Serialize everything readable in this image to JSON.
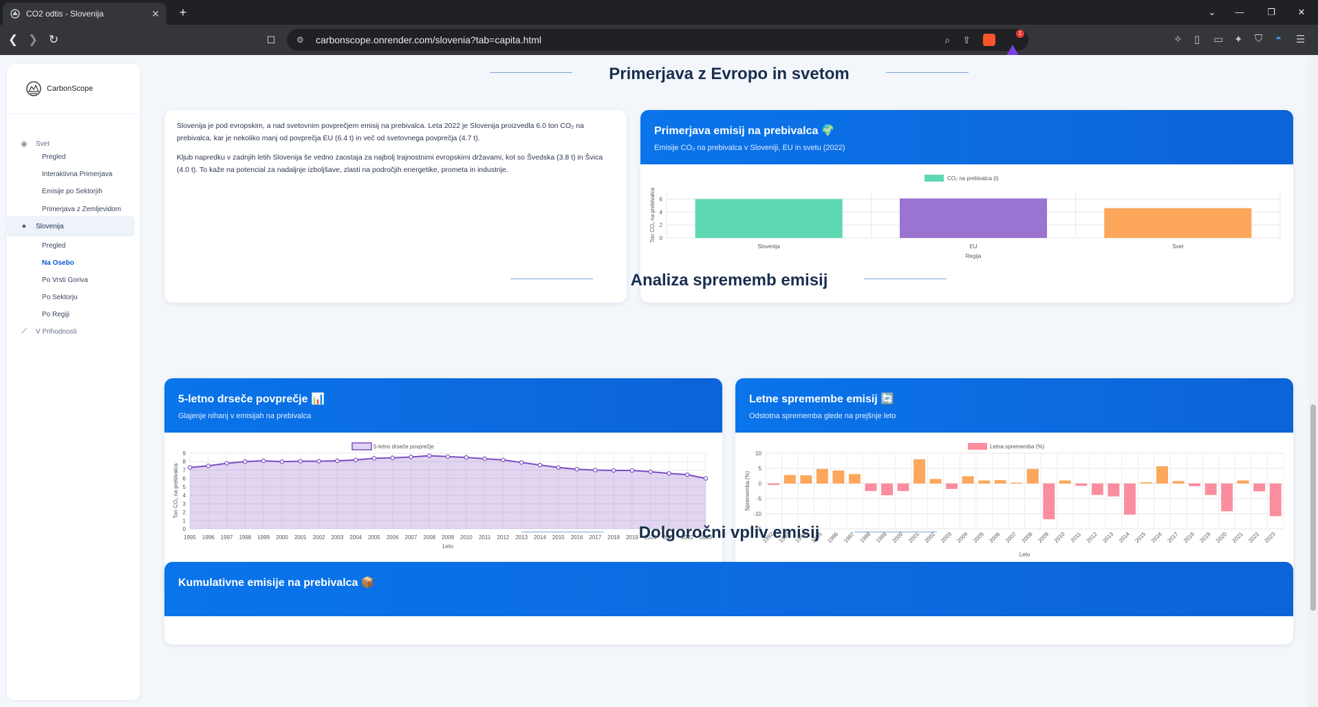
{
  "browser": {
    "tab_title": "CO2 odtis - Slovenija",
    "url": "carbonscope.onrender.com/slovenia?tab=capita.html",
    "reward_count": "1"
  },
  "sidebar": {
    "brand": "CarbonScope",
    "sections": [
      {
        "label": "Svet",
        "icon": "globe-icon",
        "items": [
          "Pregled",
          "Interaktivna Primerjava",
          "Emisije po Sektorjih",
          "Primerjava z Zemljevidom"
        ]
      },
      {
        "label": "Slovenija",
        "icon": "map-pin-icon",
        "items": [
          "Pregled",
          "Na Osebo",
          "Po Vrsti Goriva",
          "Po Sektorju",
          "Po Regiji"
        ]
      },
      {
        "label": "V Prihodnosti",
        "icon": "line-chart-icon",
        "items": []
      }
    ],
    "current_item": "Na Osebo"
  },
  "sections": {
    "europe": "Primerjava z Evropo in svetom",
    "changes": "Analiza sprememb emisij",
    "longterm": "Dolgoročni vpliv emisij"
  },
  "intro": {
    "p1": "Slovenija je pod evropskim, a nad svetovnim povprečjem emisij na prebivalca. Leta 2022 je Slovenija proizvedla 6.0 ton CO₂ na prebivalca, kar je nekoliko manj od povprečja EU (6.4 t) in več od svetovnega povprečja (4.7 t).",
    "p2": "Kljub napredku v zadnjih letih Slovenija še vedno zaostaja za najbolj trajnostnimi evropskimi državami, kot so Švedska (3.8 t) in Švica (4.0 t). To kaže na potencial za nadaljnje izboljšave, zlasti na področjih energetike, prometa in industrije."
  },
  "cards": {
    "compare": {
      "title": "Primerjava emisij na prebivalca 🌍",
      "subtitle": "Emisije CO₂ na prebivalca v Sloveniji, EU in svetu (2022)"
    },
    "rolling": {
      "title": "5-letno drseče povprečje 📊",
      "subtitle": "Glajenje nihanj v emisijah na prebivalca"
    },
    "annual": {
      "title": "Letne spremembe emisij 🔄",
      "subtitle": "Odstotna sprememba glede na prejšnje leto"
    },
    "cumulative": {
      "title": "Kumulativne emisije na prebivalca 📦"
    }
  },
  "chart_data": [
    {
      "type": "bar",
      "categories": [
        "Slovenija",
        "EU",
        "Svet"
      ],
      "series": [
        {
          "name": "CO₂ na prebivalca (t)",
          "values": [
            6.0,
            6.1,
            4.6
          ]
        }
      ],
      "colors": [
        "#5ed8b3",
        "#9b74d1",
        "#fca75b"
      ],
      "xlabel": "Regija",
      "ylabel": "Ton CO₂ na prebivalca",
      "ylim": [
        0,
        7
      ],
      "yticks": [
        0,
        2,
        4,
        6
      ]
    },
    {
      "type": "area",
      "x": [
        "1995",
        "1996",
        "1997",
        "1998",
        "1999",
        "2000",
        "2001",
        "2002",
        "2003",
        "2004",
        "2005",
        "2006",
        "2007",
        "2008",
        "2009",
        "2010",
        "2011",
        "2012",
        "2013",
        "2014",
        "2015",
        "2016",
        "2017",
        "2018",
        "2019",
        "2020",
        "2021",
        "2022",
        "2023"
      ],
      "series": [
        {
          "name": "5-letno drseče povprečje",
          "values": [
            7.3,
            7.5,
            7.8,
            8.0,
            8.1,
            8.0,
            8.05,
            8.05,
            8.1,
            8.2,
            8.4,
            8.45,
            8.55,
            8.7,
            8.6,
            8.5,
            8.35,
            8.2,
            7.9,
            7.6,
            7.3,
            7.1,
            7.0,
            6.95,
            6.95,
            6.8,
            6.6,
            6.45,
            6.0
          ]
        }
      ],
      "color": "#7b4cc4",
      "xlabel": "Leto",
      "ylabel": "Ton CO₂ na prebivalca",
      "ylim": [
        0,
        9
      ],
      "yticks": [
        0,
        1,
        2,
        3,
        4,
        5,
        6,
        7,
        8,
        9
      ]
    },
    {
      "type": "bar",
      "x": [
        "1992",
        "1993",
        "1994",
        "1995",
        "1996",
        "1997",
        "1998",
        "1999",
        "2000",
        "2001",
        "2002",
        "2003",
        "2004",
        "2005",
        "2006",
        "2007",
        "2008",
        "2009",
        "2010",
        "2011",
        "2012",
        "2013",
        "2014",
        "2015",
        "2016",
        "2017",
        "2018",
        "2019",
        "2020",
        "2021",
        "2022",
        "2023"
      ],
      "series": [
        {
          "name": "Letna sprememba (%)",
          "values": [
            -0.5,
            2.8,
            2.7,
            4.8,
            4.3,
            3.1,
            -2.5,
            -3.9,
            -2.5,
            8.0,
            1.5,
            -1.8,
            2.4,
            1.0,
            1.1,
            0.3,
            4.8,
            -11.8,
            1.0,
            -0.8,
            -3.8,
            -4.3,
            -10.3,
            0.4,
            5.7,
            0.8,
            -0.9,
            -3.8,
            -9.2,
            1.0,
            -2.6,
            -10.8
          ]
        }
      ],
      "positive_color": "#fca75b",
      "negative_color": "#fb8e9e",
      "xlabel": "Leto",
      "ylabel": "Sprememba (%)",
      "ylim": [
        -15,
        10
      ],
      "yticks": [
        -15,
        -10,
        -5,
        0,
        5,
        10
      ]
    }
  ]
}
